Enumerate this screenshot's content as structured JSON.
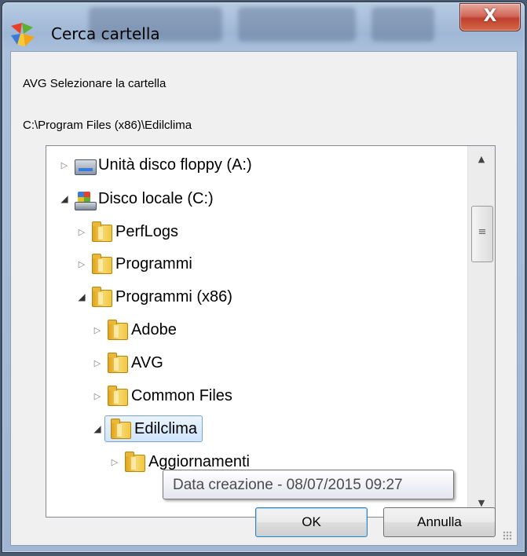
{
  "window": {
    "title": "Cerca cartella",
    "close_label": "X",
    "prompt": "AVG Selezionare la cartella",
    "current_path": "C:\\Program Files (x86)\\Edilclima"
  },
  "tree": {
    "items": [
      {
        "label": "Unità disco floppy (A:)",
        "icon": "floppy-drive-icon",
        "level": 0,
        "expanded": false
      },
      {
        "label": "Disco locale (C:)",
        "icon": "local-disk-icon",
        "level": 0,
        "expanded": true
      },
      {
        "label": "PerfLogs",
        "icon": "folder-icon",
        "level": 1,
        "expanded": false
      },
      {
        "label": "Programmi",
        "icon": "folder-icon",
        "level": 1,
        "expanded": false
      },
      {
        "label": "Programmi (x86)",
        "icon": "folder-icon",
        "level": 1,
        "expanded": true
      },
      {
        "label": "Adobe",
        "icon": "folder-icon",
        "level": 2,
        "expanded": false
      },
      {
        "label": "AVG",
        "icon": "folder-icon",
        "level": 2,
        "expanded": false
      },
      {
        "label": "Common Files",
        "icon": "folder-icon",
        "level": 2,
        "expanded": false
      },
      {
        "label": "Edilclima",
        "icon": "folder-icon",
        "level": 2,
        "expanded": true,
        "selected": true
      },
      {
        "label": "Aggiornamenti",
        "icon": "folder-icon",
        "level": 3,
        "expanded": false
      }
    ]
  },
  "tooltip": "Data creazione - 08/07/2015 09:27",
  "buttons": {
    "ok": "OK",
    "cancel": "Annulla"
  },
  "colors": {
    "selection_border": "#7da2ce",
    "selection_fill": "#cfe4fb",
    "close_button": "#c0402e"
  }
}
